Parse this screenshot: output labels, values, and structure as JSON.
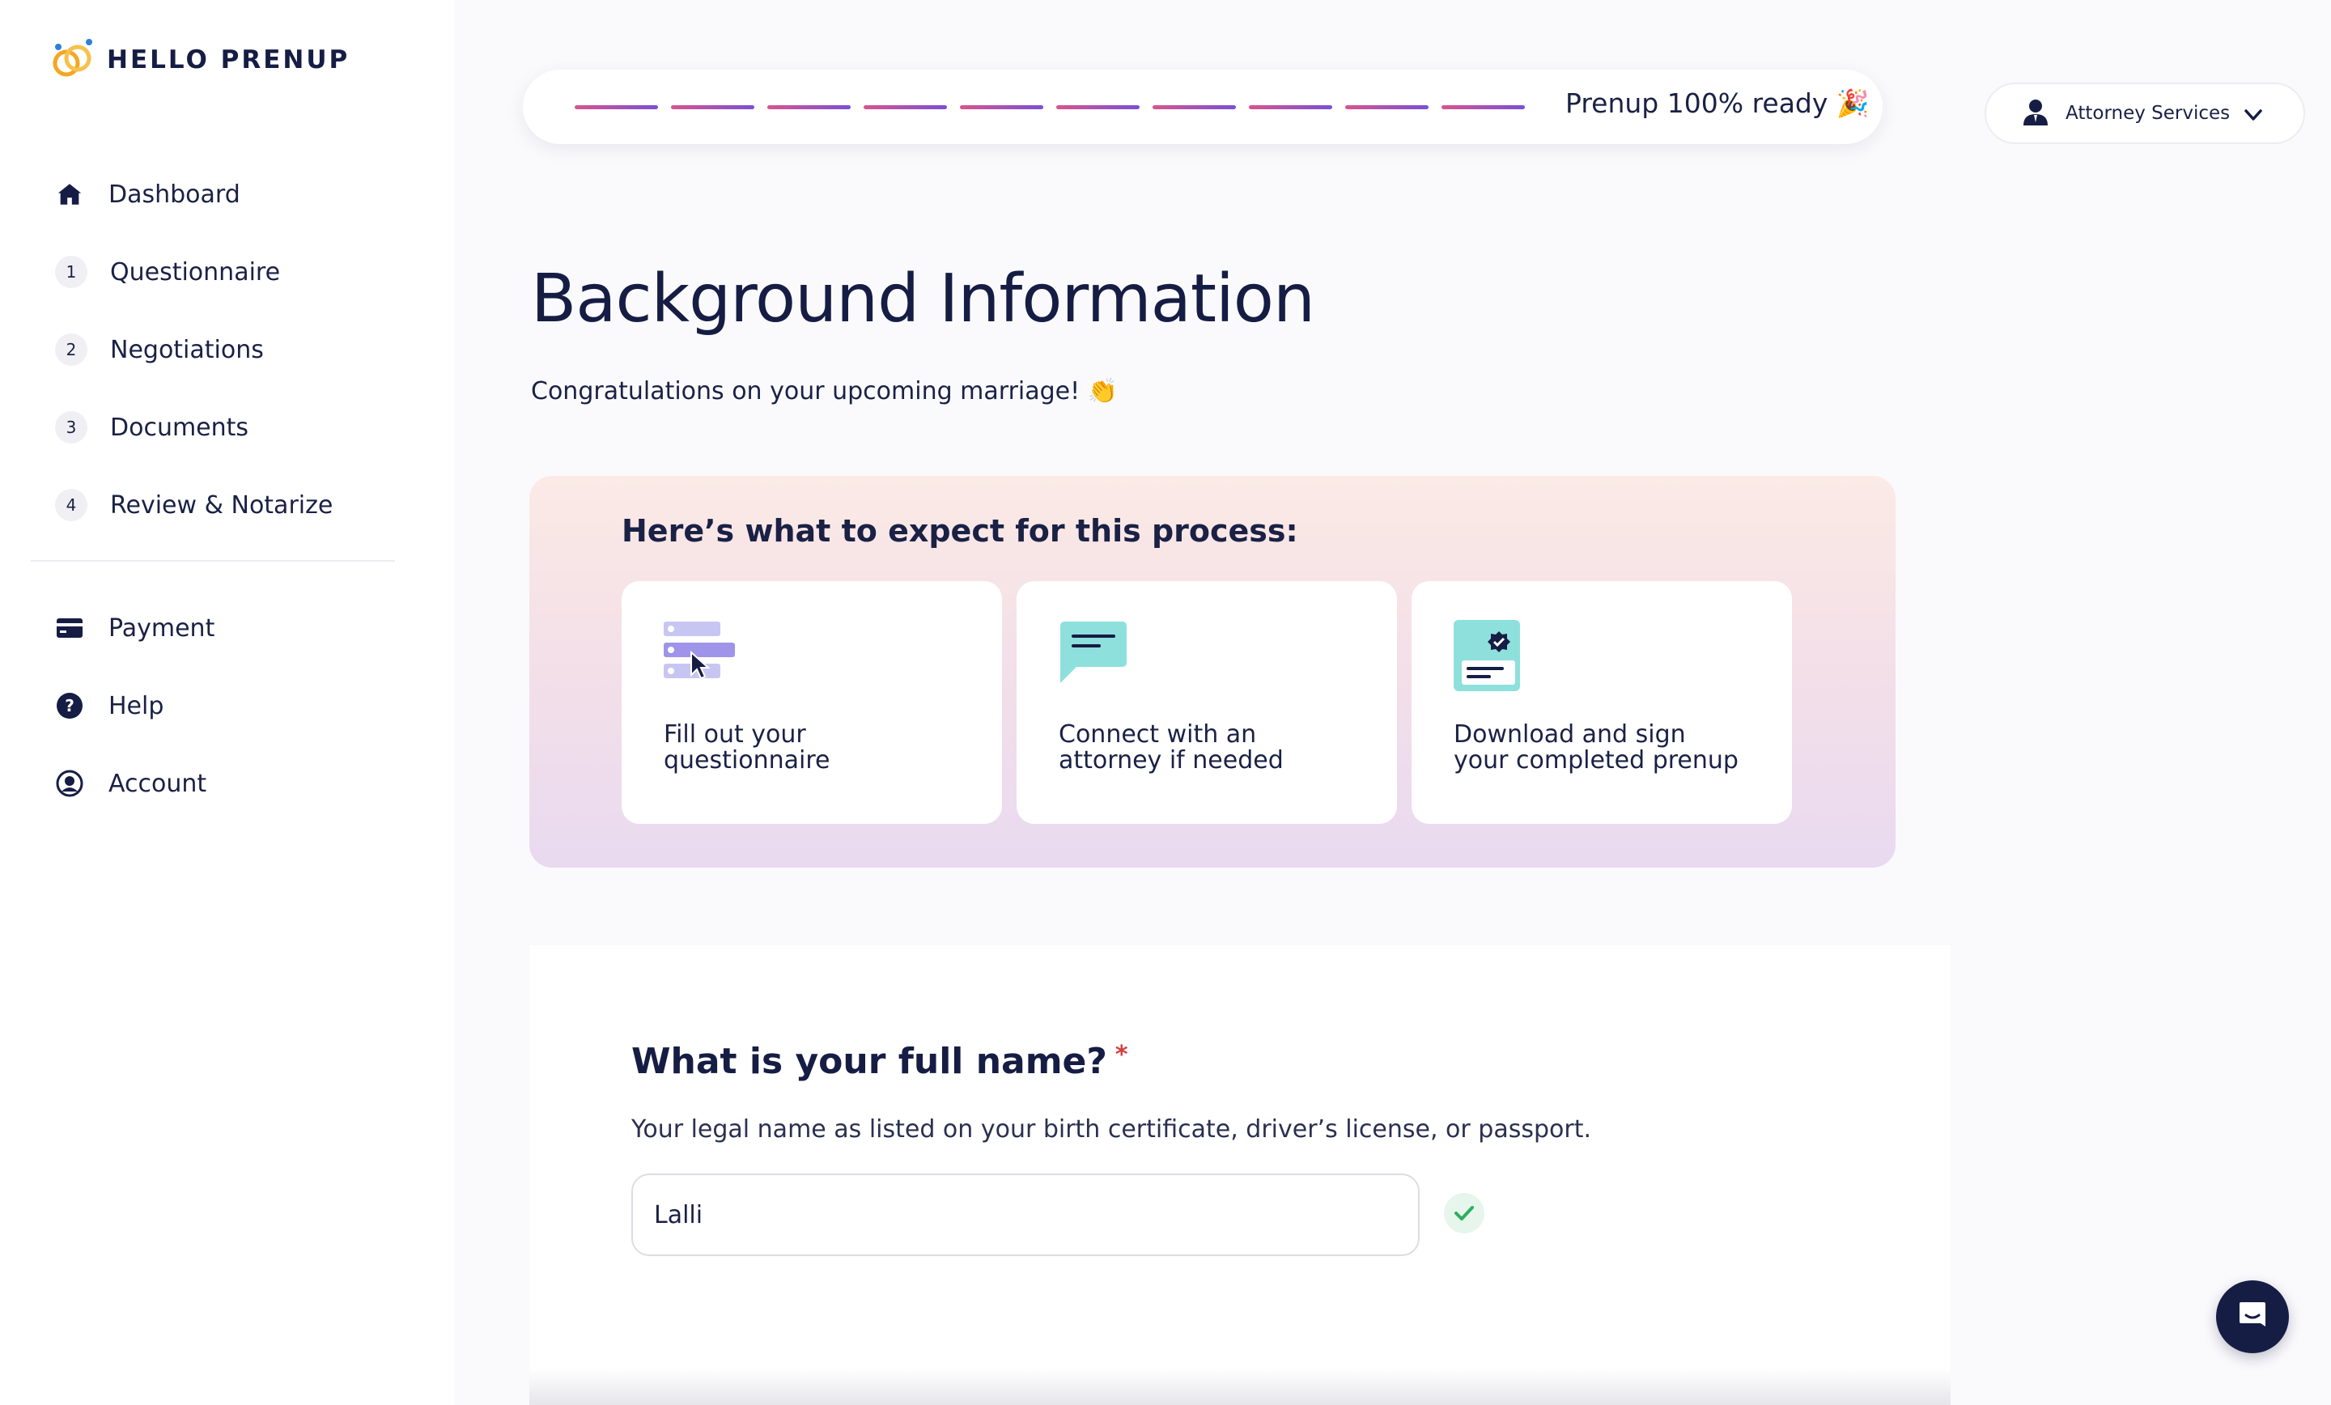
{
  "brand": {
    "name": "HELLO PRENUP"
  },
  "sidebar": {
    "items": [
      {
        "label": "Dashboard",
        "icon": "home-icon"
      },
      {
        "label": "Questionnaire",
        "step": "1"
      },
      {
        "label": "Negotiations",
        "step": "2"
      },
      {
        "label": "Documents",
        "step": "3"
      },
      {
        "label": "Review & Notarize",
        "step": "4"
      }
    ],
    "secondary": [
      {
        "label": "Payment",
        "icon": "credit-card-icon"
      },
      {
        "label": "Help",
        "icon": "help-icon"
      },
      {
        "label": "Account",
        "icon": "account-icon"
      }
    ]
  },
  "progress": {
    "label": "Prenup 100% ready 🎉",
    "segments_total": 10,
    "segments_complete": 10,
    "colors": {
      "start": "#d8548f",
      "end": "#7b4fd6"
    }
  },
  "attorney": {
    "label": "Attorney Services",
    "icon": "person-icon"
  },
  "main": {
    "title": "Background Information",
    "subtitle": "Congratulations on your upcoming marriage! 👏"
  },
  "expect": {
    "title": "Here’s what to expect for this process:",
    "steps": [
      {
        "text": "Fill out your\nquestionnaire",
        "icon": "form-list-icon"
      },
      {
        "text": "Connect with an\nattorney if needed",
        "icon": "chat-bubble-icon"
      },
      {
        "text": "Download and sign\nyour completed prenup",
        "icon": "certificate-icon"
      }
    ]
  },
  "form": {
    "question": "What is your full name?",
    "required_mark": "*",
    "hint": "Your legal name as listed on your birth certificate, driver’s license, or passport.",
    "name_value": "Lalli"
  },
  "colors": {
    "navy": "#161d44",
    "accent_orange": "#f5a623",
    "accent_blue": "#2a7fe0",
    "success": "#2eae60"
  }
}
